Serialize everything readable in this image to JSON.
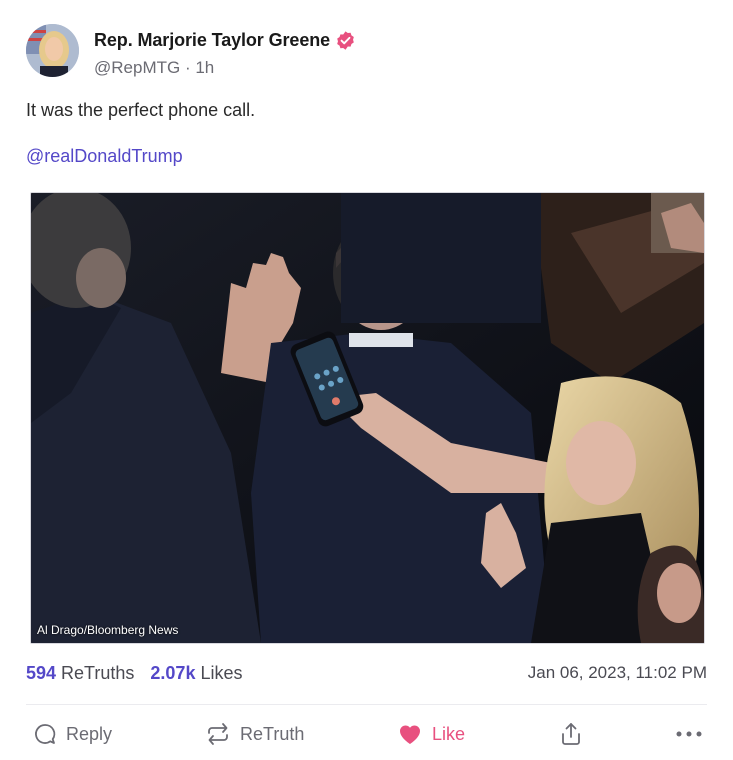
{
  "post": {
    "author": {
      "display_name": "Rep. Marjorie Taylor Greene",
      "handle": "@RepMTG",
      "time_ago": "1h",
      "verified_color": "#e8507f"
    },
    "text": "It was the perfect phone call.",
    "mention": "@realDonaldTrump",
    "media": {
      "photo_credit": "Al Drago/Bloomberg News"
    },
    "stats": {
      "retruths_count": "594",
      "retruths_label": "ReTruths",
      "likes_count": "2.07k",
      "likes_label": "Likes"
    },
    "timestamp": "Jan 06, 2023, 11:02 PM",
    "actions": {
      "reply": "Reply",
      "retruth": "ReTruth",
      "like": "Like"
    }
  },
  "colors": {
    "accent": "#5448c8",
    "like": "#e8507f",
    "muted": "#6b6b73"
  }
}
